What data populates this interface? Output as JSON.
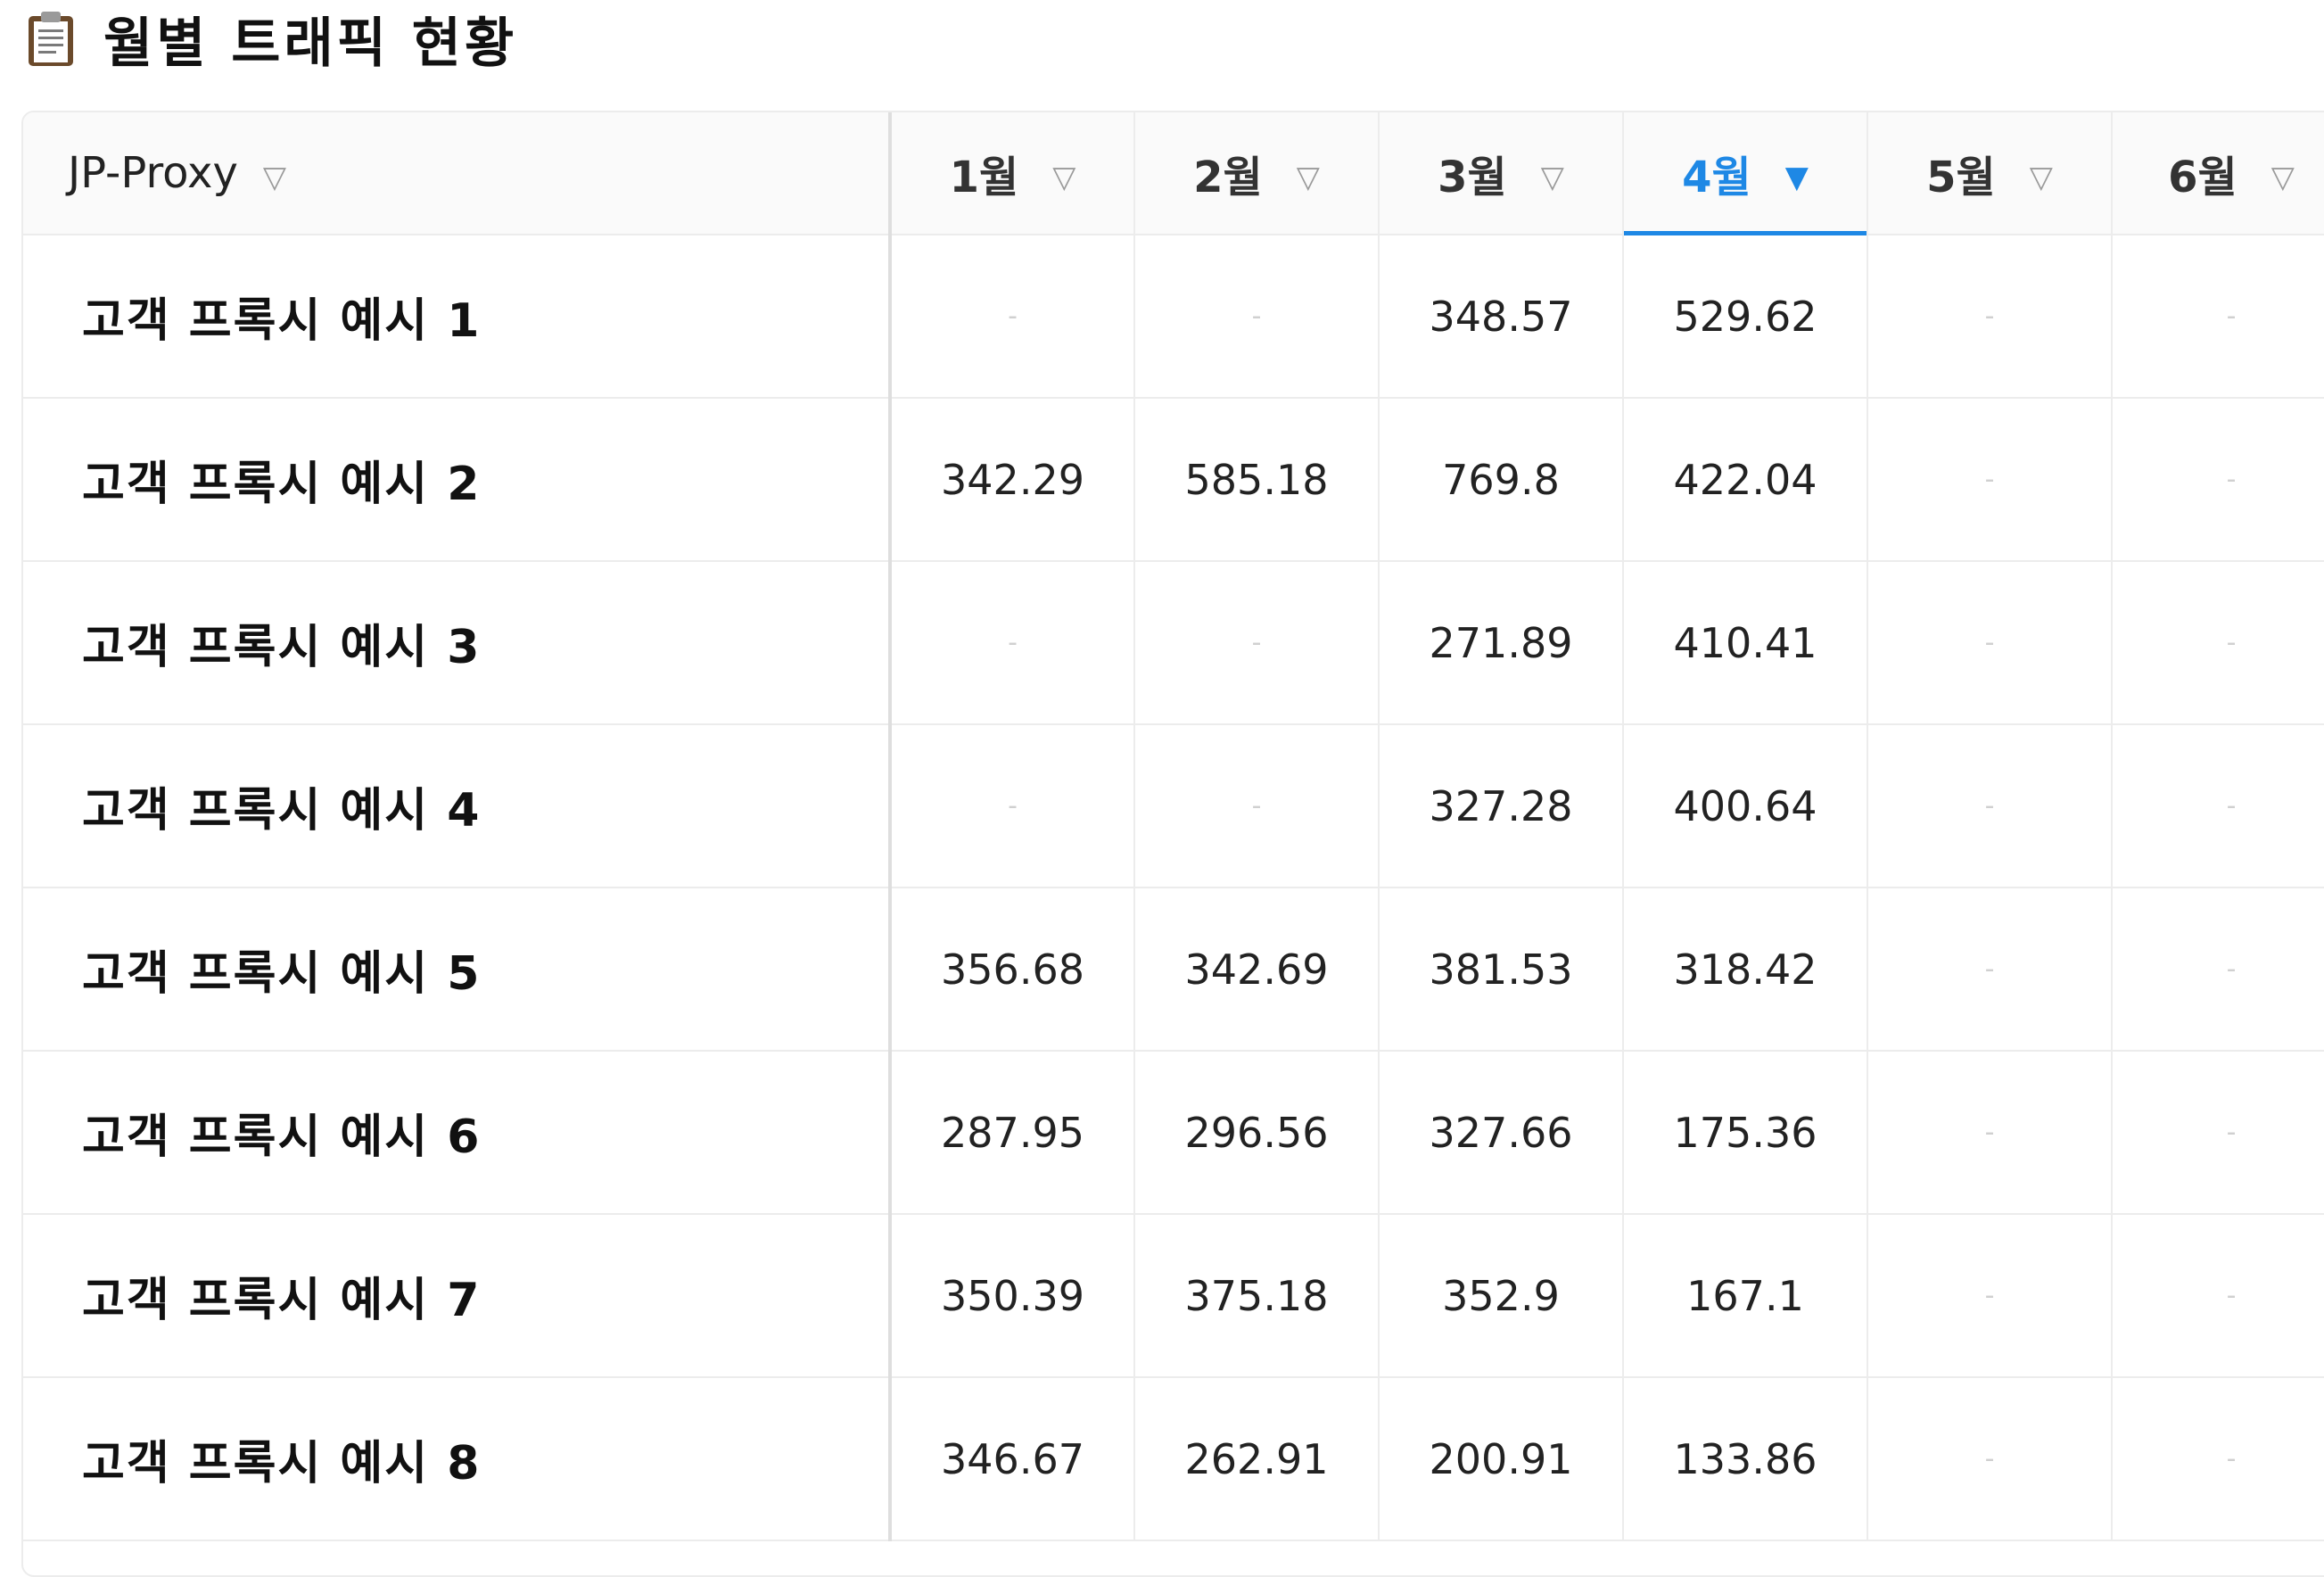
{
  "header": {
    "title": "월별 트래픽 현황",
    "icon": "clipboard-icon"
  },
  "table": {
    "columns": [
      {
        "label": "JP-Proxy",
        "sort_icon": "filter-outline-icon",
        "active": false
      },
      {
        "label": "1월",
        "sort_icon": "filter-outline-icon",
        "active": false
      },
      {
        "label": "2월",
        "sort_icon": "filter-outline-icon",
        "active": false
      },
      {
        "label": "3월",
        "sort_icon": "filter-outline-icon",
        "active": false
      },
      {
        "label": "4월",
        "sort_icon": "filter-filled-icon",
        "active": true
      },
      {
        "label": "5월",
        "sort_icon": "filter-outline-icon",
        "active": false
      },
      {
        "label": "6월",
        "sort_icon": "filter-outline-icon",
        "active": false
      }
    ],
    "rows": [
      {
        "name": "고객 프록시 예시 1",
        "values": [
          "-",
          "-",
          "348.57",
          "529.62",
          "-",
          "-"
        ]
      },
      {
        "name": "고객 프록시 예시 2",
        "values": [
          "342.29",
          "585.18",
          "769.8",
          "422.04",
          "-",
          "-"
        ]
      },
      {
        "name": "고객 프록시 예시 3",
        "values": [
          "-",
          "-",
          "271.89",
          "410.41",
          "-",
          "-"
        ]
      },
      {
        "name": "고객 프록시 예시 4",
        "values": [
          "-",
          "-",
          "327.28",
          "400.64",
          "-",
          "-"
        ]
      },
      {
        "name": "고객 프록시 예시 5",
        "values": [
          "356.68",
          "342.69",
          "381.53",
          "318.42",
          "-",
          "-"
        ]
      },
      {
        "name": "고객 프록시 예시 6",
        "values": [
          "287.95",
          "296.56",
          "327.66",
          "175.36",
          "-",
          "-"
        ]
      },
      {
        "name": "고객 프록시 예시 7",
        "values": [
          "350.39",
          "375.18",
          "352.9",
          "167.1",
          "-",
          "-"
        ]
      },
      {
        "name": "고객 프록시 예시 8",
        "values": [
          "346.67",
          "262.91",
          "200.91",
          "133.86",
          "-",
          "-"
        ]
      }
    ]
  },
  "colors": {
    "accent": "#1e88e5",
    "border": "#ececec",
    "header_bg": "#fafafa"
  }
}
